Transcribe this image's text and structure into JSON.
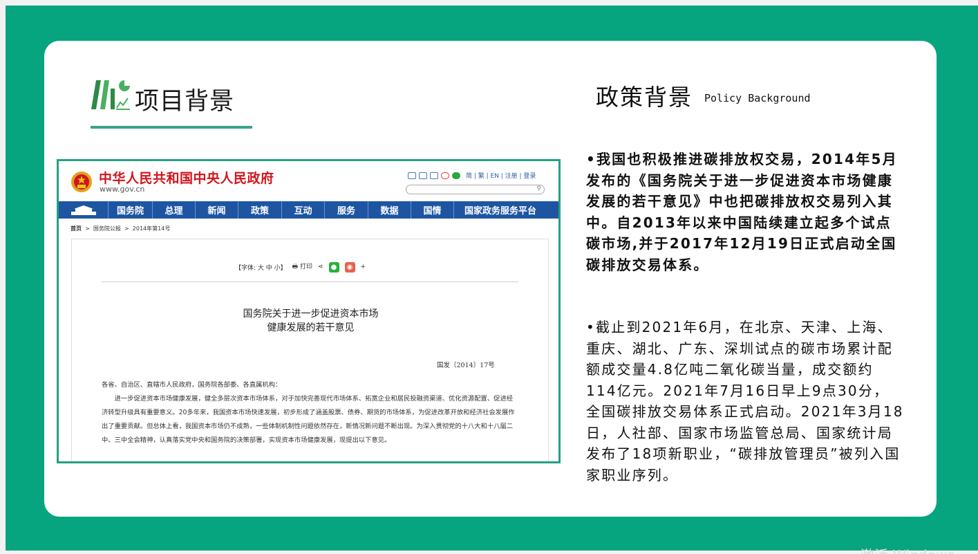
{
  "header": {
    "section_title": "项目背景",
    "policy_title": "政策背景",
    "policy_subtitle": "Policy Background"
  },
  "gov_site": {
    "site_name": "中华人民共和国中央人民政府",
    "url": "www.gov.cn",
    "top_links": "简 | 繁 | EN | 注册 | 登录",
    "nav": [
      "国务院",
      "总理",
      "新闻",
      "政策",
      "互动",
      "服务",
      "数据",
      "国情",
      "国家政务服务平台"
    ],
    "breadcrumb": {
      "home": "首页",
      "sep": ">",
      "level1": "国务院公报",
      "level2": "2014年第14号"
    },
    "tools": {
      "font_size": "【字体: 大 中 小】",
      "print": "打印",
      "more": "+"
    },
    "article_title_line1": "国务院关于进一步促进资本市场",
    "article_title_line2": "健康发展的若干意见",
    "doc_number": "国发〔2014〕17号",
    "salutation": "各省、自治区、直辖市人民政府，国务院各部委、各直属机构：",
    "paragraph": "进一步促进资本市场健康发展，健全多层次资本市场体系，对于加快完善现代市场体系、拓宽企业和居民投融资渠道、优化资源配置、促进经济转型升级具有重要意义。20多年来，我国资本市场快速发展，初步形成了涵盖股票、债券、期货的市场体系，为促进改革开放和经济社会发展作出了重要贡献。但总体上看，我国资本市场仍不成熟，一些体制机制性问题依然存在，新情况新问题不断出现。为深入贯彻党的十八大和十八届二中、三中全会精神，认真落实党中央和国务院的决策部署，实现资本市场健康发展，现提出以下意见。"
  },
  "bullets": [
    "•我国也积极推进碳排放权交易，2014年5月发布的《国务院关于进一步促进资本市场健康发展的若干意见》中也把碳排放权交易列入其中。自2013年以来中国陆续建立起多个试点碳市场,并于2017年12月19日正式启动全国碳排放交易体系。",
    "•截止到2021年6月，在北京、天津、上海、重庆、湖北、广东、深圳试点的碳市场累计配额成交量4.8亿吨二氧化碳当量，成交额约114亿元。2021年7月16日早上9点30分，全国碳排放交易体系正式启动。2021年3月18日，人社部、国家市场监管总局、国家统计局发布了18项新职业，“碳排放管理员”被列入国家职业序列。"
  ],
  "watermark": "激活 Windows",
  "colors": {
    "background": "#07a57f",
    "accent": "#3aa38e",
    "gov_red": "#d1151c",
    "gov_blue": "#1d55a3"
  }
}
